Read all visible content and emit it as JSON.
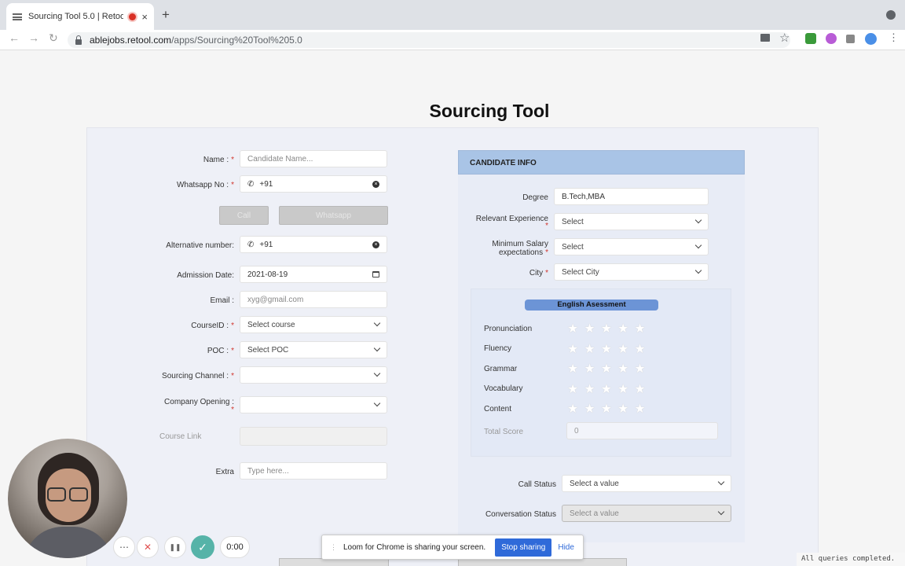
{
  "browser": {
    "tab_title": "Sourcing Tool 5.0 | Retool",
    "tab_close": "×",
    "new_tab": "+",
    "url_host": "ablejobs.retool.com",
    "url_path": "/apps/Sourcing%20Tool%205.0",
    "nav_back": "←",
    "nav_forward": "→",
    "nav_reload": "↻"
  },
  "page": {
    "title": "Sourcing Tool"
  },
  "form": {
    "name": {
      "label": "Name :",
      "placeholder": "Candidate Name..."
    },
    "whatsapp": {
      "label": "Whatsapp No :",
      "value": "+91"
    },
    "call_button": "Call",
    "whatsapp_button": "Whatsapp",
    "alternative": {
      "label": "Alternative number:",
      "value": "+91"
    },
    "admission": {
      "label": "Admission Date:",
      "value": "2021-08-19"
    },
    "email": {
      "label": "Email :",
      "placeholder": "xyg@gmail.com"
    },
    "course": {
      "label": "CourseID :",
      "placeholder": "Select course"
    },
    "poc": {
      "label": "POC :",
      "placeholder": "Select POC"
    },
    "sourcing": {
      "label": "Sourcing Channel :"
    },
    "company": {
      "label": "Company Opening :"
    },
    "course_link": {
      "label": "Course Link"
    },
    "extra": {
      "label": "Extra",
      "placeholder": "Type here..."
    },
    "required_mark": "*",
    "phone_glyph": "✆",
    "clear_glyph": "×"
  },
  "candidate": {
    "header": "CANDIDATE INFO",
    "degree": {
      "label": "Degree",
      "value": "B.Tech,MBA"
    },
    "experience": {
      "label": "Relevant Experience",
      "placeholder": "Select"
    },
    "salary": {
      "label1": "Minimum Salary",
      "label2": "expectations",
      "placeholder": "Select"
    },
    "city": {
      "label": "City",
      "placeholder": "Select City"
    },
    "english": {
      "title": "English Asessment",
      "items": [
        "Pronunciation",
        "Fluency",
        "Grammar",
        "Vocabulary",
        "Content"
      ],
      "stars": "★★★★★",
      "rating_max": 5,
      "total_label": "Total Score",
      "total_value": "0"
    },
    "call_status": {
      "label": "Call Status",
      "placeholder": "Select a value"
    },
    "conversation_status": {
      "label": "Conversation Status",
      "placeholder": "Select a value"
    }
  },
  "loom": {
    "message": "Loom for Chrome is sharing your screen.",
    "stop": "Stop sharing",
    "hide": "Hide",
    "timer": "0:00",
    "more": "⋯",
    "cancel": "✕",
    "pause": "❚❚",
    "done": "✓"
  },
  "status": {
    "queries": "All queries completed."
  }
}
